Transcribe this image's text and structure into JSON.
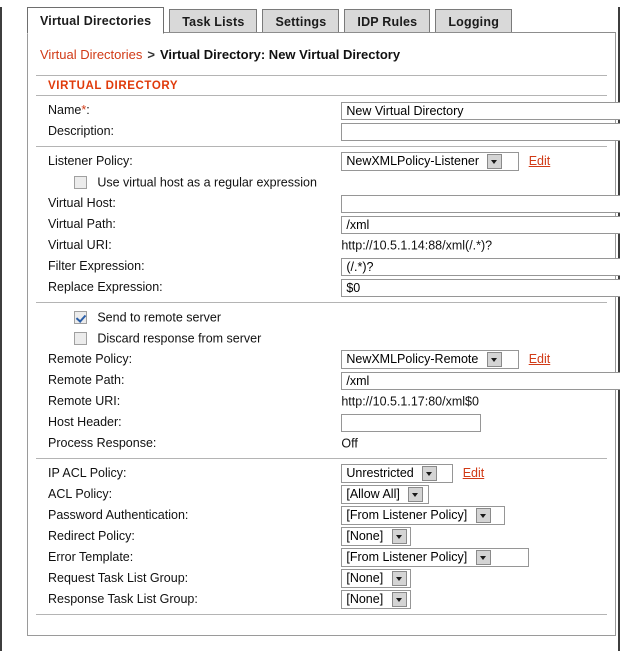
{
  "tabs": [
    {
      "label": "Virtual Directories",
      "active": true
    },
    {
      "label": "Task Lists",
      "active": false
    },
    {
      "label": "Settings",
      "active": false
    },
    {
      "label": "IDP Rules",
      "active": false
    },
    {
      "label": "Logging",
      "active": false
    }
  ],
  "breadcrumb": {
    "link": "Virtual Directories",
    "separator": ">",
    "current": "Virtual Directory: New Virtual Directory"
  },
  "section": {
    "title": "VIRTUAL DIRECTORY"
  },
  "fields": {
    "name_label": "Name*:",
    "name_value": "New Virtual Directory",
    "description_label": "Description:",
    "description_value": "",
    "listener_policy_label": "Listener Policy:",
    "listener_policy_value": "NewXMLPolicy-Listener",
    "listener_policy_edit": "Edit",
    "use_virtual_host_regex_label": "Use virtual host as a regular expression",
    "virtual_host_label": "Virtual Host:",
    "virtual_host_value": "",
    "virtual_path_label": "Virtual Path:",
    "virtual_path_value": "/xml",
    "virtual_uri_label": "Virtual URI:",
    "virtual_uri_value": "http://10.5.1.14:88/xml(/.*)?",
    "filter_expression_label": "Filter Expression:",
    "filter_expression_value": "(/.*)?",
    "replace_expression_label": "Replace Expression:",
    "replace_expression_value": "$0",
    "send_to_remote_server_label": "Send to remote server",
    "discard_response_label": "Discard response from server",
    "remote_policy_label": "Remote Policy:",
    "remote_policy_value": "NewXMLPolicy-Remote",
    "remote_policy_edit": "Edit",
    "remote_path_label": "Remote Path:",
    "remote_path_value": "/xml",
    "remote_uri_label": "Remote URI:",
    "remote_uri_value": "http://10.5.1.17:80/xml$0",
    "host_header_label": "Host Header:",
    "host_header_value": "",
    "process_response_label": "Process Response:",
    "process_response_value": "Off",
    "ip_acl_policy_label": "IP ACL Policy:",
    "ip_acl_policy_value": "Unrestricted",
    "ip_acl_policy_edit": "Edit",
    "acl_policy_label": "ACL Policy:",
    "acl_policy_value": "[Allow All]",
    "password_auth_label": "Password Authentication:",
    "password_auth_value": "[From Listener Policy]",
    "redirect_policy_label": "Redirect Policy:",
    "redirect_policy_value": "[None]",
    "error_template_label": "Error Template:",
    "error_template_value": "[From Listener Policy]",
    "request_task_list_group_label": "Request Task List Group:",
    "request_task_list_group_value": "[None]",
    "response_task_list_group_label": "Response Task List Group:",
    "response_task_list_group_value": "[None]"
  },
  "checkboxes": {
    "use_virtual_host_regex_checked": false,
    "send_to_remote_server_checked": true,
    "discard_response_checked": false
  },
  "colors": {
    "accent": "#d13a16",
    "section_heading": "#e03a0a",
    "check_mark": "#2b5fa8",
    "tab_inactive_bg": "#d9d9d9"
  }
}
